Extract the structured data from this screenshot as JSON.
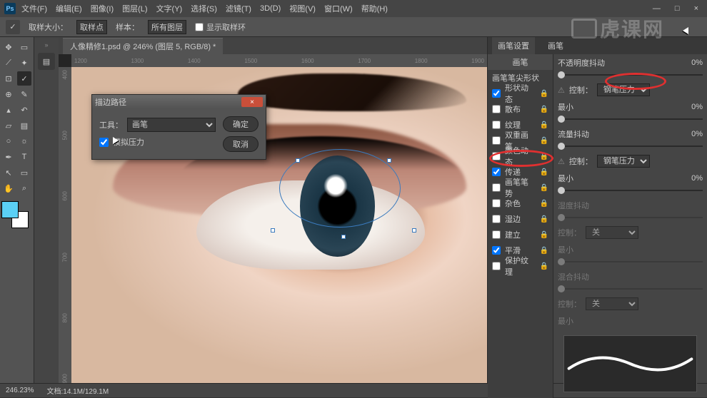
{
  "menu": {
    "items": [
      "文件(F)",
      "编辑(E)",
      "图像(I)",
      "图层(L)",
      "文字(Y)",
      "选择(S)",
      "滤镜(T)",
      "3D(D)",
      "视图(V)",
      "窗口(W)",
      "帮助(H)"
    ]
  },
  "winctrl": {
    "min": "—",
    "max": "□",
    "close": "×"
  },
  "optbar": {
    "label_sample_size": "取样大小：",
    "sample_size": "取样点",
    "label_sample": "样本：",
    "sample": "所有图层",
    "chk_ring": "显示取样环"
  },
  "doc": {
    "tab": "人像精修1.psd @ 246% (图层 5, RGB/8) *"
  },
  "ruler_h": [
    "1200",
    "1300",
    "1400",
    "1500",
    "1600",
    "1700",
    "1800",
    "1900"
  ],
  "ruler_v": [
    "400",
    "500",
    "600",
    "700",
    "800",
    "900"
  ],
  "dialog": {
    "title": "描边路径",
    "label_tool": "工具：",
    "tool": "画笔",
    "chk_pressure": "模拟压力",
    "ok": "确定",
    "cancel": "取消"
  },
  "panel": {
    "tabs": [
      "画笔设置",
      "画笔"
    ],
    "left": {
      "header": "画笔",
      "shape": "画笔笔尖形状",
      "items": [
        {
          "label": "形状动态",
          "checked": true
        },
        {
          "label": "散布",
          "checked": false
        },
        {
          "label": "纹理",
          "checked": false
        },
        {
          "label": "双重画笔",
          "checked": false
        },
        {
          "label": "颜色动态",
          "checked": false
        },
        {
          "label": "传递",
          "checked": true
        },
        {
          "label": "画笔笔势",
          "checked": false
        },
        {
          "label": "杂色",
          "checked": false
        },
        {
          "label": "湿边",
          "checked": false
        },
        {
          "label": "建立",
          "checked": false
        },
        {
          "label": "平滑",
          "checked": true
        },
        {
          "label": "保护纹理",
          "checked": false
        }
      ]
    },
    "right": {
      "opacity_jitter": "不透明度抖动",
      "opacity_val": "0%",
      "control": "控制：",
      "control_val": "钢笔压力",
      "min": "最小",
      "min_val": "0%",
      "flow_jitter": "流量抖动",
      "flow_val": "0%",
      "control2_val": "钢笔压力",
      "min2_val": "0%",
      "wet_jitter": "湿度抖动",
      "control_off": "关",
      "mix_jitter": "混合抖动"
    }
  },
  "status": {
    "zoom": "246.23%",
    "docinfo": "文档:14.1M/129.1M"
  },
  "watermark": "虎课网",
  "icons": {
    "move": "✥",
    "marquee": "▭",
    "lasso": "⟋",
    "wand": "✦",
    "crop": "⊡",
    "eyedrop": "✓",
    "heal": "⊕",
    "brush": "✎",
    "stamp": "▴",
    "history": "↶",
    "eraser": "▱",
    "grad": "▤",
    "blur": "○",
    "dodge": "☼",
    "pen": "✒",
    "type": "T",
    "path": "↖",
    "shape": "▭",
    "hand": "✋",
    "zoom": "⌕",
    "lock": "🔒",
    "warn": "⚠"
  }
}
